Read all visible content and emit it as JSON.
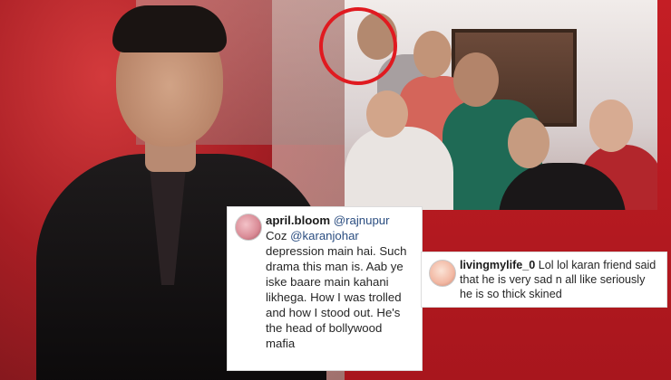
{
  "comments": [
    {
      "username": "april.bloom",
      "mention_1": "@rajnupur",
      "prefix": "Coz ",
      "mention_2": "@karanjohar",
      "text": "depression main hai. Such drama this man is. Aab ye iske baare main kahani likhega. How I was trolled and how I stood out. He's the head of bollywood mafia"
    },
    {
      "username": "livingmylife_0",
      "text": "Lol lol karan friend said that he is very sad n all like seriously he is so thick skined"
    }
  ],
  "colors": {
    "backdrop_red": "#c41e25",
    "highlight_circle": "#e01a20",
    "mention_blue": "#2a4d80"
  }
}
